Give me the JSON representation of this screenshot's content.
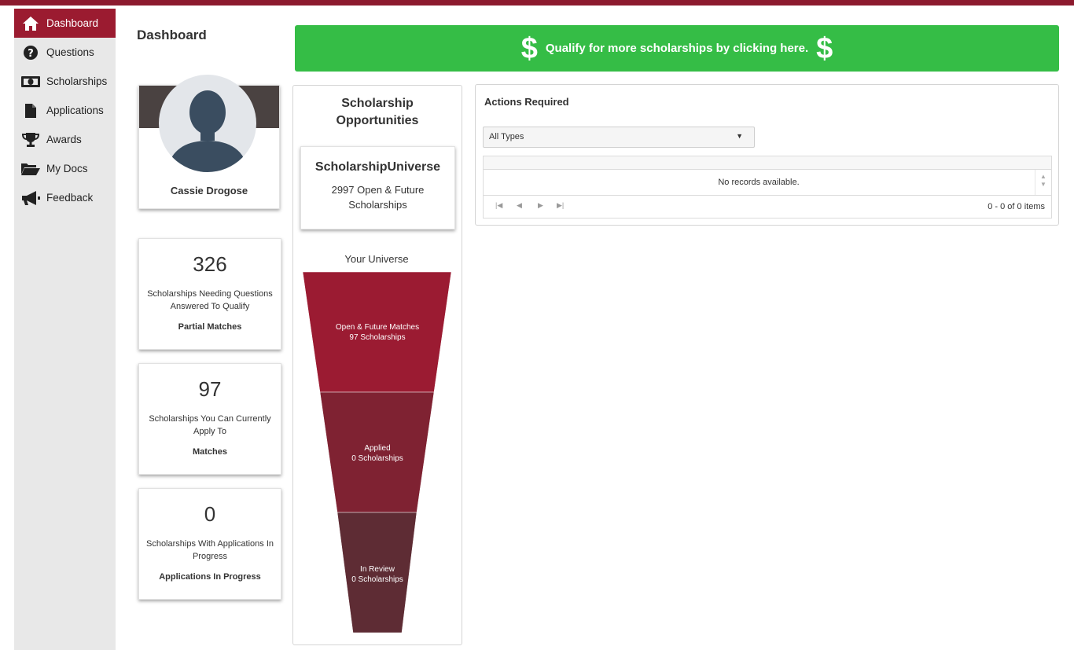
{
  "sidebar": {
    "items": [
      {
        "label": "Dashboard",
        "icon": "home-icon",
        "active": true
      },
      {
        "label": "Questions",
        "icon": "question-circle-icon"
      },
      {
        "label": "Scholarships",
        "icon": "money-bill-icon"
      },
      {
        "label": "Applications",
        "icon": "file-icon"
      },
      {
        "label": "Awards",
        "icon": "trophy-icon"
      },
      {
        "label": "My Docs",
        "icon": "folder-open-icon"
      },
      {
        "label": "Feedback",
        "icon": "megaphone-icon"
      }
    ]
  },
  "header": {
    "title": "Dashboard"
  },
  "cta": {
    "dollar": "$",
    "text": "Qualify for more scholarships by clicking here."
  },
  "profile": {
    "name": "Cassie Drogose"
  },
  "stats": [
    {
      "number": "326",
      "description": "Scholarships Needing Questions Answered To Qualify",
      "kind": "Partial Matches"
    },
    {
      "number": "97",
      "description": "Scholarships You Can Currently Apply To",
      "kind": "Matches"
    },
    {
      "number": "0",
      "description": "Scholarships With Applications In Progress",
      "kind": "Applications In Progress"
    }
  ],
  "opportunities": {
    "title_line1": "Scholarship",
    "title_line2": "Opportunities",
    "universe_card": {
      "name": "ScholarshipUniverse",
      "desc_line1": "2997 Open & Future",
      "desc_line2": "Scholarships"
    },
    "universe_label": "Your Universe",
    "funnel": [
      {
        "line1": "Open & Future Matches",
        "line2": "97 Scholarships",
        "color": "#9b1b32"
      },
      {
        "line1": "Applied",
        "line2": "0 Scholarships",
        "color": "#7f2232"
      },
      {
        "line1": "In Review",
        "line2": "0 Scholarships",
        "color": "#5e2c34"
      }
    ]
  },
  "actions": {
    "title": "Actions Required",
    "filter_value": "All Types",
    "empty_text": "No records available.",
    "pager_info": "0 - 0 of 0 items"
  },
  "colors": {
    "brand": "#9b1b30",
    "cta": "#35bd46",
    "top_bar": "#8c1a2e"
  }
}
